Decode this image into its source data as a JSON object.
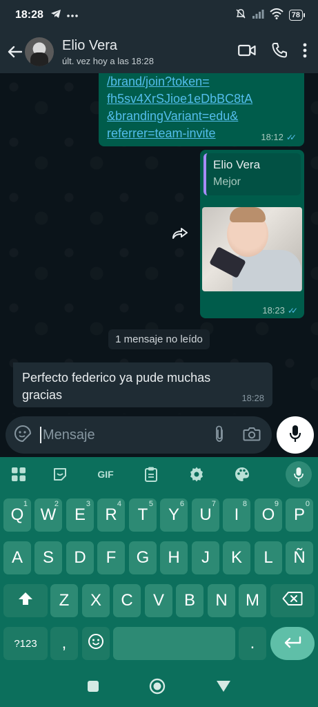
{
  "status_bar": {
    "time": "18:28",
    "battery": "78"
  },
  "header": {
    "contact_name": "Elio Vera",
    "last_seen": "últ. vez hoy a las 18:28"
  },
  "messages": [
    {
      "direction": "out",
      "type": "link",
      "lines": [
        "/brand/join?token=",
        "fh5sv4XrSJioe1eDbBC8tA",
        "&brandingVariant=edu&",
        "referrer=team-invite"
      ],
      "time": "18:12",
      "status": "read"
    },
    {
      "direction": "out",
      "type": "image_reply",
      "quote_author": "Elio Vera",
      "quote_text": "Mejor",
      "time": "18:23",
      "status": "read"
    },
    {
      "direction": "in",
      "type": "text",
      "text": "Perfecto federico ya pude muchas gracias",
      "time": "18:28"
    }
  ],
  "unread_banner": "1 mensaje no leído",
  "composer": {
    "placeholder": "Mensaje"
  },
  "keyboard": {
    "toolbar": [
      "apps",
      "sticker",
      "GIF",
      "clipboard",
      "settings",
      "theme",
      "mic"
    ],
    "row1": [
      {
        "k": "Q",
        "h": "1"
      },
      {
        "k": "W",
        "h": "2"
      },
      {
        "k": "E",
        "h": "3"
      },
      {
        "k": "R",
        "h": "4"
      },
      {
        "k": "T",
        "h": "5"
      },
      {
        "k": "Y",
        "h": "6"
      },
      {
        "k": "U",
        "h": "7"
      },
      {
        "k": "I",
        "h": "8"
      },
      {
        "k": "O",
        "h": "9"
      },
      {
        "k": "P",
        "h": "0"
      }
    ],
    "row2": [
      "A",
      "S",
      "D",
      "F",
      "G",
      "H",
      "J",
      "K",
      "L",
      "Ñ"
    ],
    "row3": [
      "Z",
      "X",
      "C",
      "V",
      "B",
      "N",
      "M"
    ],
    "symbols_label": "?123",
    "comma": ",",
    "period": "."
  },
  "colors": {
    "accent_green": "#005c4b",
    "link_blue": "#53bdeb",
    "keyboard_bg": "#0c6f5c"
  }
}
